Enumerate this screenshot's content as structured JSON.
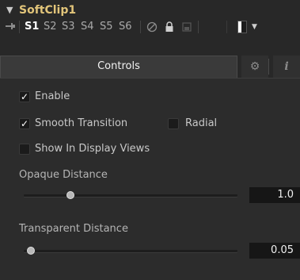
{
  "header": {
    "title": "SoftClip1",
    "collapse_icon": "chevron-down-icon"
  },
  "toolbar": {
    "pin_icon": "pin-icon",
    "slots": [
      "S1",
      "S2",
      "S3",
      "S4",
      "S5",
      "S6"
    ],
    "active_slot": "S1",
    "disable_icon": "disabled-circle-icon",
    "lock_icon": "lock-icon",
    "cache_icon": "cache-icon",
    "color_swatch_icon": "color-swatch-icon",
    "dropdown_icon": "caret-down-icon"
  },
  "tabs": {
    "controls_label": "Controls",
    "settings_icon": "gear-icon",
    "info_icon": "info-icon"
  },
  "controls": {
    "enable": {
      "label": "Enable",
      "checked": true
    },
    "smooth_transition": {
      "label": "Smooth Transition",
      "checked": true
    },
    "radial": {
      "label": "Radial",
      "checked": false
    },
    "show_in_display_views": {
      "label": "Show In Display Views",
      "checked": false
    },
    "opaque_distance": {
      "label": "Opaque Distance",
      "value": "1.0"
    },
    "transparent_distance": {
      "label": "Transparent Distance",
      "value": "0.05"
    }
  },
  "colors": {
    "title": "#e2c57a",
    "background": "#282828",
    "panel": "#2c2c2c"
  }
}
